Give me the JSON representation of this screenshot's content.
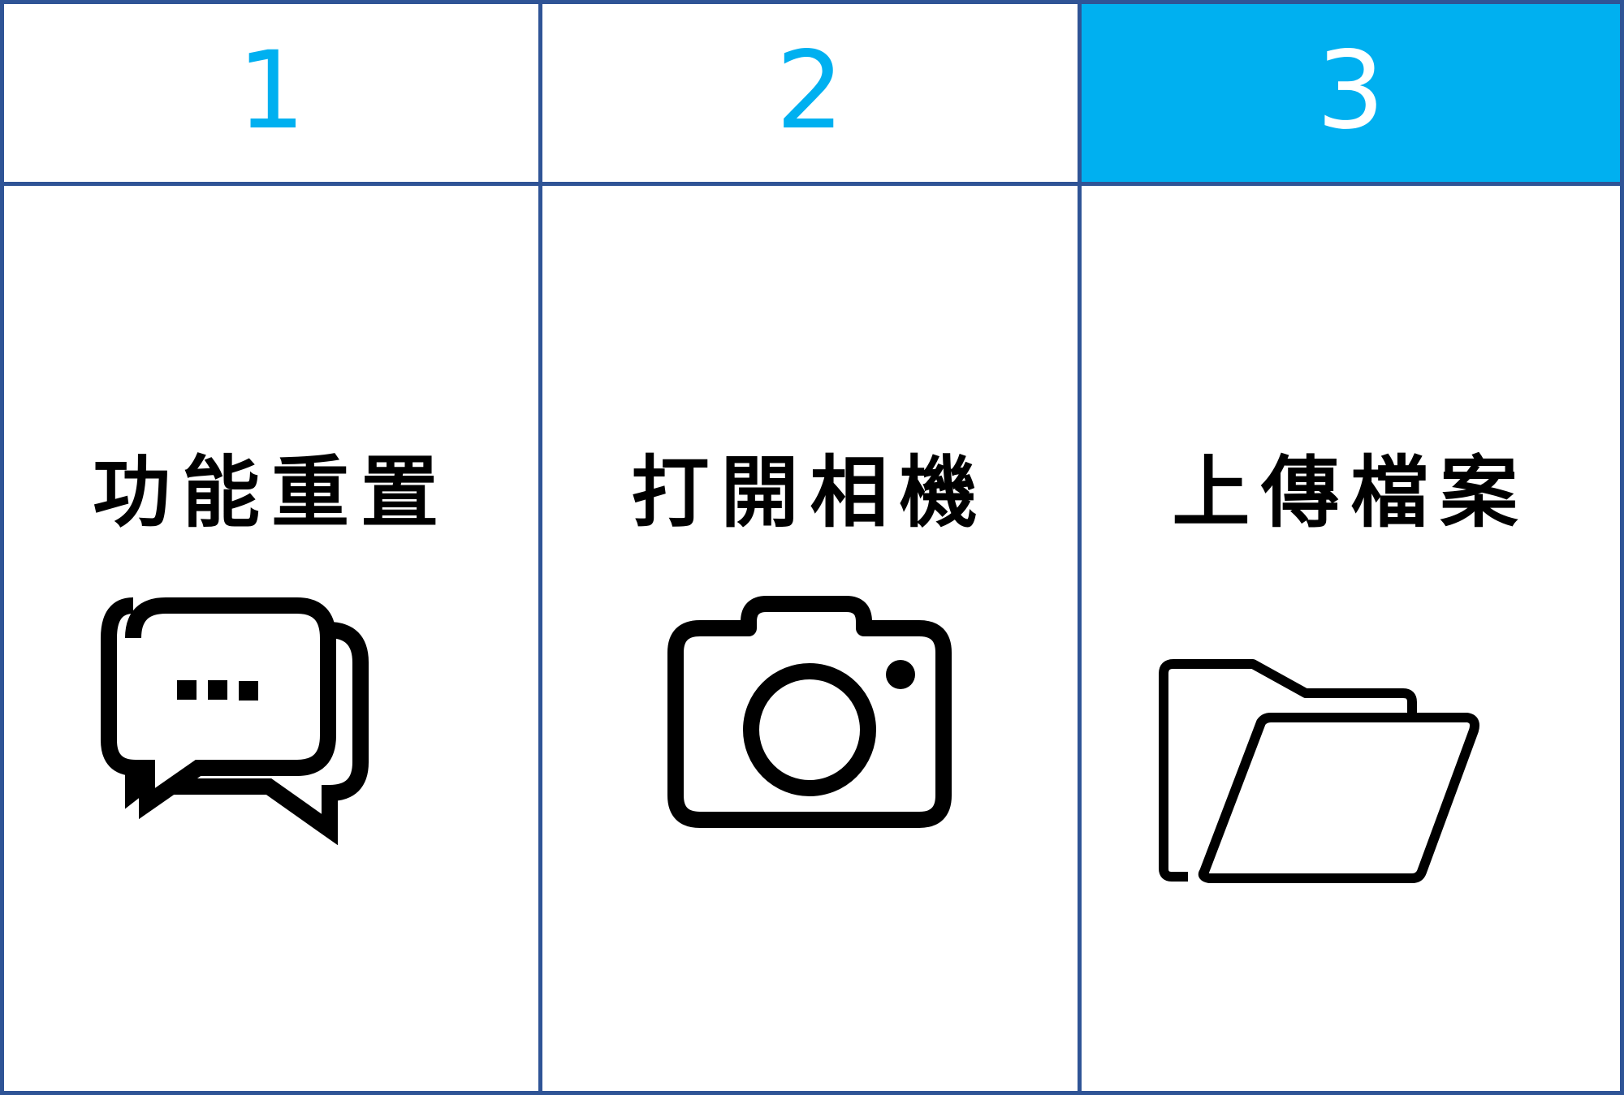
{
  "tabs": [
    {
      "label": "1",
      "active": false
    },
    {
      "label": "2",
      "active": false
    },
    {
      "label": "3",
      "active": true
    }
  ],
  "panels": [
    {
      "label": "功能重置",
      "icon": "chat-bubbles-icon"
    },
    {
      "label": "打開相機",
      "icon": "camera-icon"
    },
    {
      "label": "上傳檔案",
      "icon": "folder-open-icon"
    }
  ],
  "colors": {
    "accent": "#00b0f0",
    "border": "#2f5496",
    "icon": "#000000"
  }
}
